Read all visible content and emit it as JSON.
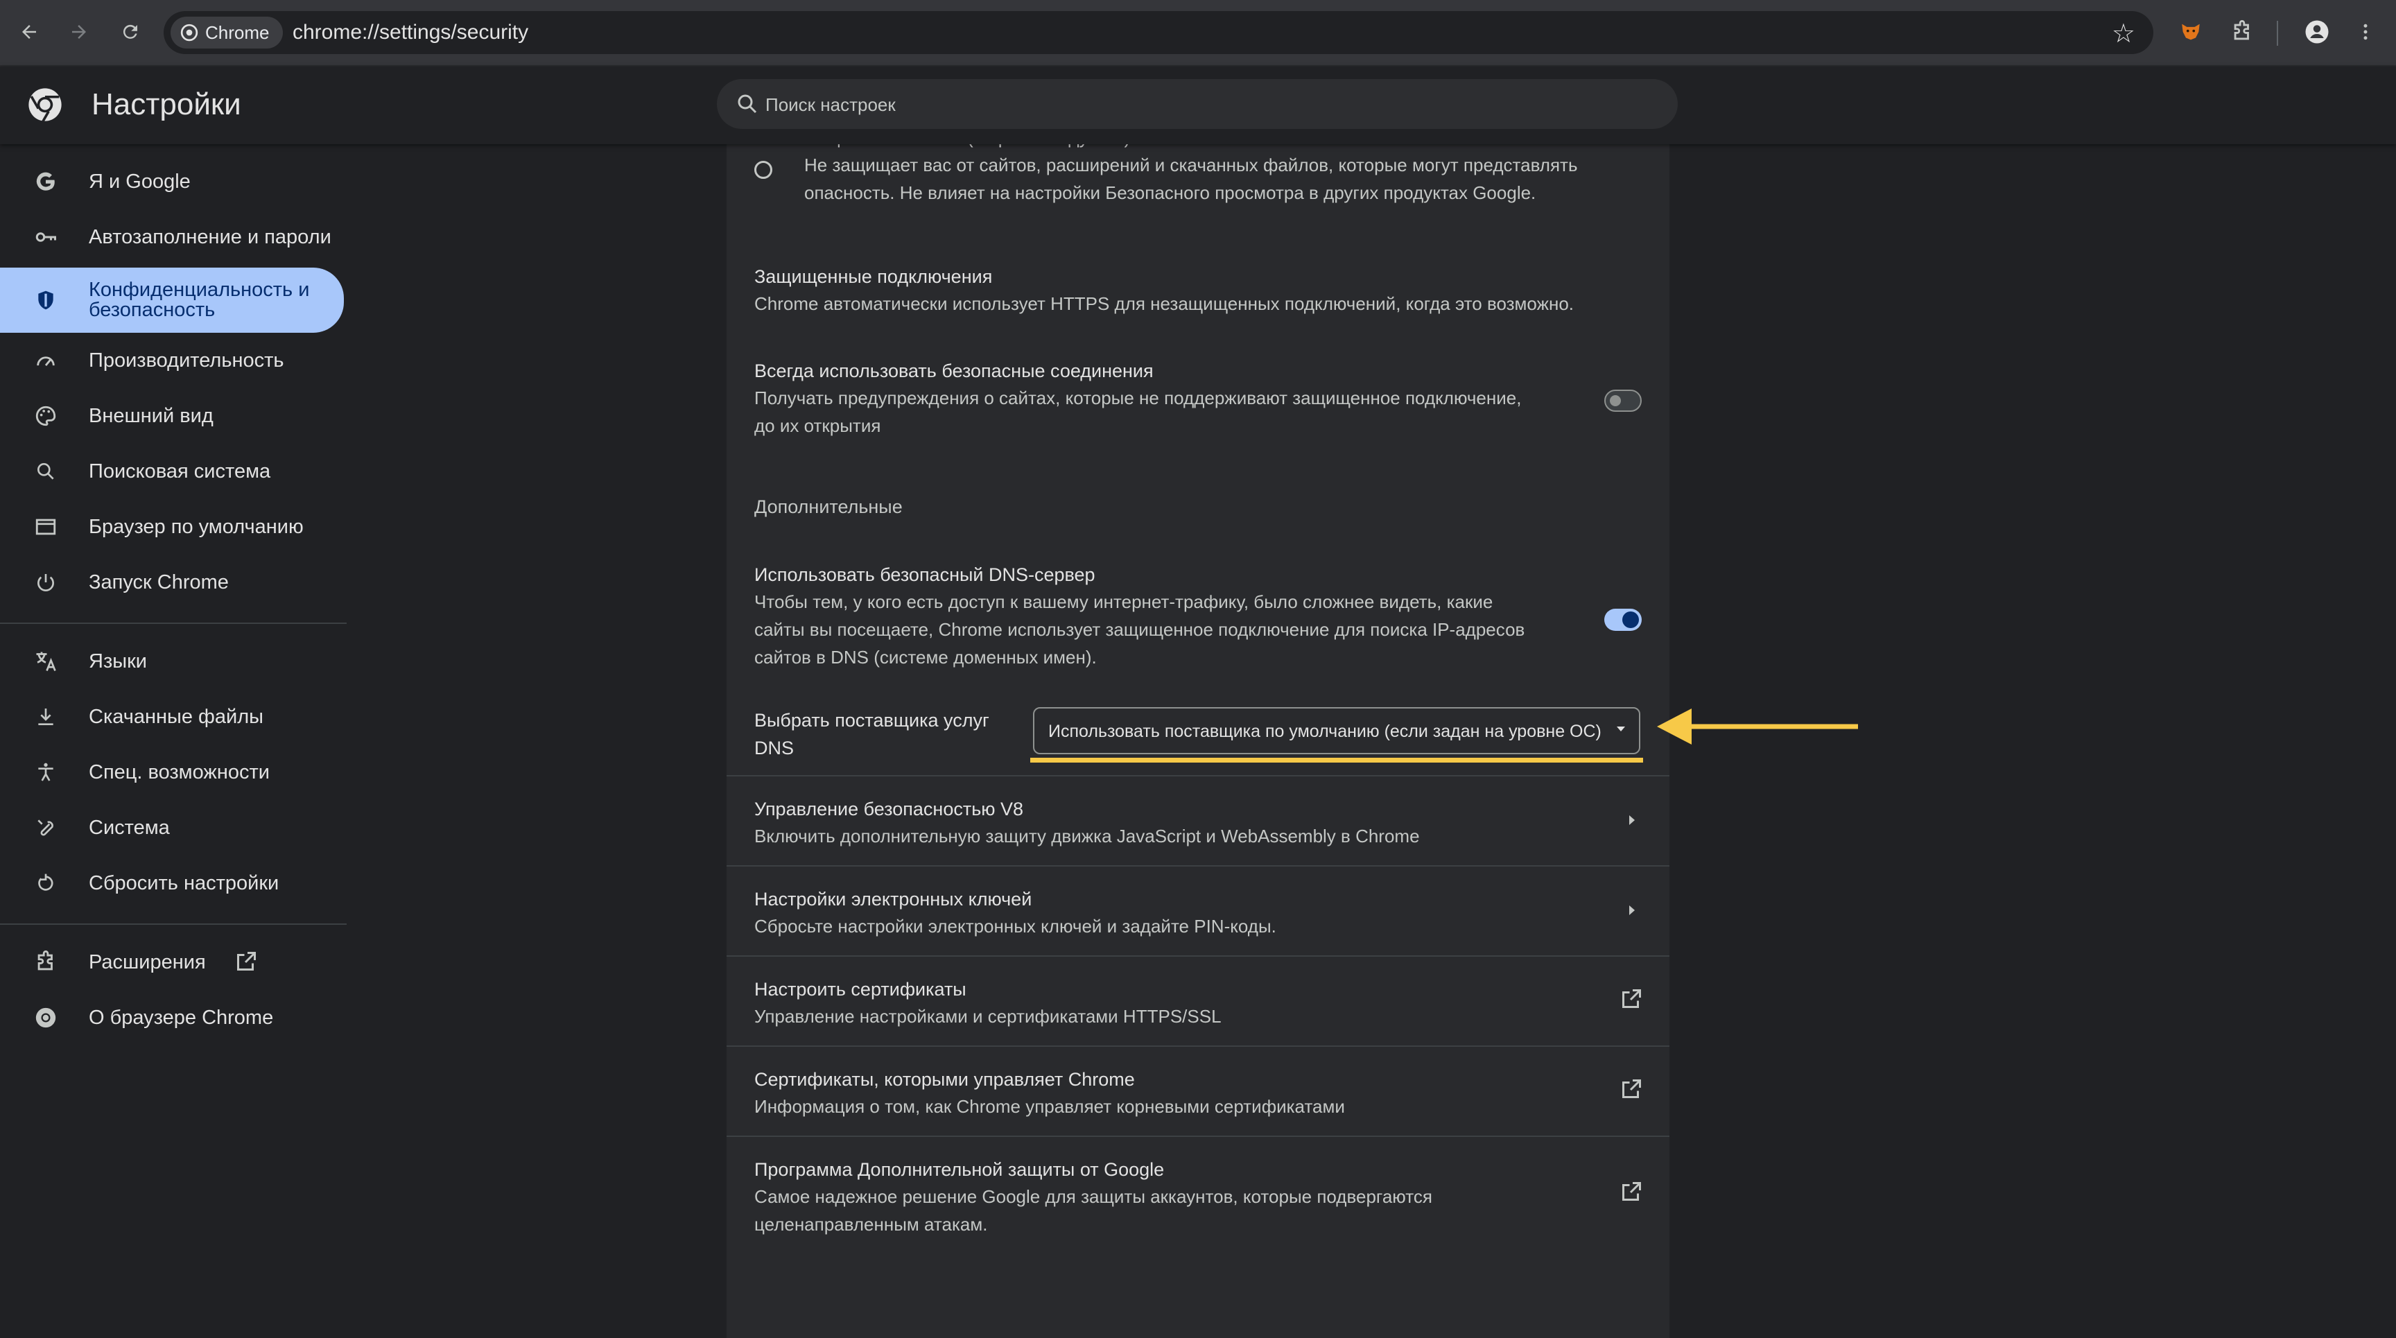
{
  "browser": {
    "chip_label": "Chrome",
    "url": "chrome://settings/security"
  },
  "header": {
    "title": "Настройки",
    "search_placeholder": "Поиск настроек"
  },
  "sidebar": {
    "items": [
      {
        "label": "Я и Google",
        "icon": "google-g-icon"
      },
      {
        "label": "Автозаполнение и пароли",
        "icon": "key-icon"
      },
      {
        "label": "Конфиденциальность и безопасность",
        "label_line1": "Конфиденциальность и",
        "label_line2": "безопасность",
        "icon": "shield-icon",
        "active": true
      },
      {
        "label": "Производительность",
        "icon": "speedometer-icon"
      },
      {
        "label": "Внешний вид",
        "icon": "palette-icon"
      },
      {
        "label": "Поисковая система",
        "icon": "search-icon"
      },
      {
        "label": "Браузер по умолчанию",
        "icon": "browser-window-icon"
      },
      {
        "label": "Запуск Chrome",
        "icon": "power-icon"
      },
      {
        "label": "Языки",
        "icon": "translate-icon"
      },
      {
        "label": "Скачанные файлы",
        "icon": "download-icon"
      },
      {
        "label": "Спец. возможности",
        "icon": "accessibility-icon"
      },
      {
        "label": "Система",
        "icon": "wrench-icon"
      },
      {
        "label": "Сбросить настройки",
        "icon": "reset-icon"
      },
      {
        "label": "Расширения",
        "icon": "puzzle-icon"
      },
      {
        "label": "О браузере Chrome",
        "icon": "chrome-icon"
      }
    ]
  },
  "content": {
    "no_protection": {
      "title_partial": "Защита отключена (не рекомендуется)",
      "desc_line1": "Не защищает вас от сайтов, расширений и скачанных файлов, которые могут представлять",
      "desc_line2": "опасность. Не влияет на настройки Безопасного просмотра в других продуктах Google."
    },
    "secure_connections": {
      "title": "Защищенные подключения",
      "desc": "Chrome автоматически использует HTTPS для незащищенных подключений, когда это возможно."
    },
    "always_secure": {
      "title": "Всегда использовать безопасные соединения",
      "desc_line1": "Получать предупреждения о сайтах, которые не поддерживают защищенное подключение,",
      "desc_line2": "до их открытия",
      "enabled": false
    },
    "advanced_heading": "Дополнительные",
    "secure_dns": {
      "title": "Использовать безопасный DNS-сервер",
      "desc_line1": "Чтобы тем, у кого есть доступ к вашему интернет-трафику, было сложнее видеть, какие",
      "desc_line2": "сайты вы посещаете, Chrome использует защищенное подключение для поиска IP-адресов",
      "desc_line3": "сайтов в DNS (системе доменных имен).",
      "enabled": true
    },
    "dns_provider": {
      "label_line1": "Выбрать поставщика услуг",
      "label_line2": "DNS",
      "selected": "Использовать поставщика по умолчанию (если задан на уровне ОС)"
    },
    "links": [
      {
        "title": "Управление безопасностью V8",
        "desc": "Включить дополнительную защиту движка JavaScript и WebAssembly в Chrome",
        "type": "arrow"
      },
      {
        "title": "Настройки электронных ключей",
        "desc": "Сбросьте настройки электронных ключей и задайте PIN-коды.",
        "type": "arrow"
      },
      {
        "title": "Настроить сертификаты",
        "desc": "Управление настройками и сертификатами HTTPS/SSL",
        "type": "external"
      },
      {
        "title": "Сертификаты, которыми управляет Chrome",
        "desc": "Информация о том, как Chrome управляет корневыми сертификатами",
        "type": "external"
      },
      {
        "title": "Программа Дополнительной защиты от Google",
        "desc_line1": "Самое надежное решение Google для защиты аккаунтов, которые подвергаются",
        "desc_line2": "целенаправленным атакам.",
        "type": "external"
      }
    ]
  },
  "annotation": {
    "highlight_color": "#f7c948"
  }
}
